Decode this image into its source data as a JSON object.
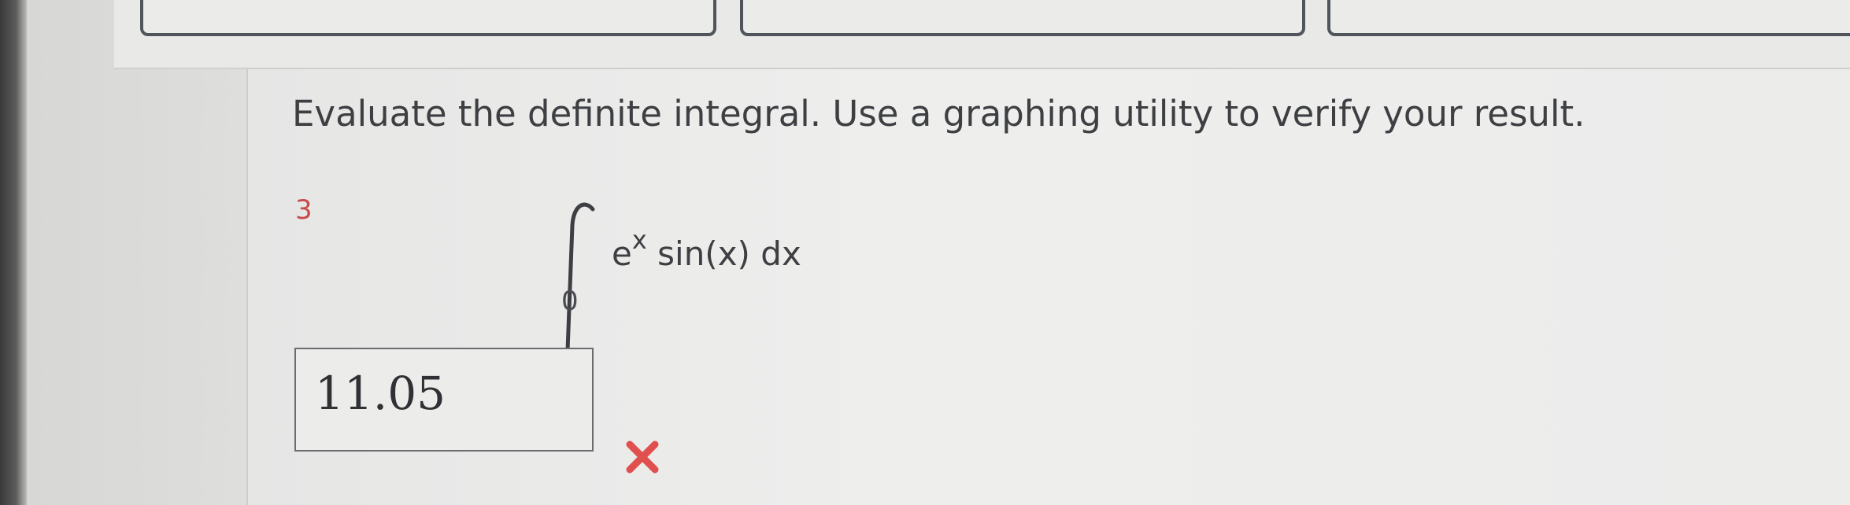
{
  "question": {
    "prompt": "Evaluate the definite integral. Use a graphing utility to verify your result.",
    "integral": {
      "upper_limit": "3",
      "lower_limit": "0",
      "base": "e",
      "exponent": "x",
      "rest": "sin(x) dx"
    }
  },
  "answer": {
    "value": "11.05",
    "status_icon": "x-mark-icon",
    "status_color": "#e0504e"
  },
  "colors": {
    "upper_limit_color": "#c94a4a",
    "nav_border": "#50555c"
  }
}
